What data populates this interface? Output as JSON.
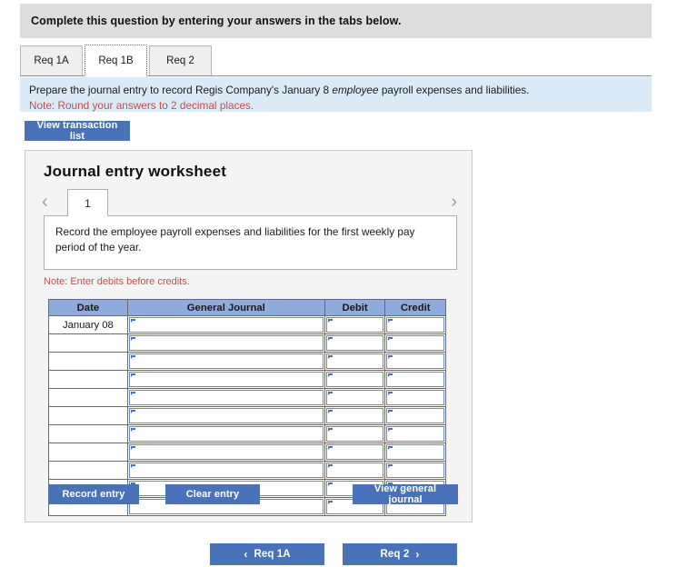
{
  "header": {
    "instruction": "Complete this question by entering your answers in the tabs below."
  },
  "tabs": {
    "items": [
      {
        "label": "Req 1A",
        "active": false
      },
      {
        "label": "Req 1B",
        "active": true
      },
      {
        "label": "Req 2",
        "active": false
      }
    ]
  },
  "prompt": {
    "line_prefix": "Prepare the journal entry to record Regis Company's January 8 ",
    "line_emphasis": "employee",
    "line_suffix": " payroll expenses and liabilities.",
    "note": "Note: Round your answers to 2 decimal places."
  },
  "toolbar": {
    "view_transaction_list": "View transaction list"
  },
  "worksheet": {
    "title": "Journal entry worksheet",
    "pager": {
      "prev_icon": "‹",
      "next_icon": "›",
      "current_page": "1"
    },
    "description": "Record the employee payroll expenses and liabilities for the first weekly pay period of the year.",
    "debit_note": "Note: Enter debits before credits.",
    "table": {
      "columns": [
        "Date",
        "General Journal",
        "Debit",
        "Credit"
      ],
      "rows": [
        {
          "date": "January 08",
          "general_journal": "",
          "debit": "",
          "credit": ""
        },
        {
          "date": "",
          "general_journal": "",
          "debit": "",
          "credit": ""
        },
        {
          "date": "",
          "general_journal": "",
          "debit": "",
          "credit": ""
        },
        {
          "date": "",
          "general_journal": "",
          "debit": "",
          "credit": ""
        },
        {
          "date": "",
          "general_journal": "",
          "debit": "",
          "credit": ""
        },
        {
          "date": "",
          "general_journal": "",
          "debit": "",
          "credit": ""
        },
        {
          "date": "",
          "general_journal": "",
          "debit": "",
          "credit": ""
        },
        {
          "date": "",
          "general_journal": "",
          "debit": "",
          "credit": ""
        },
        {
          "date": "",
          "general_journal": "",
          "debit": "",
          "credit": ""
        },
        {
          "date": "",
          "general_journal": "",
          "debit": "",
          "credit": ""
        },
        {
          "date": "",
          "general_journal": "",
          "debit": "",
          "credit": ""
        }
      ]
    },
    "actions": {
      "record_entry": "Record entry",
      "clear_entry": "Clear entry",
      "view_general_journal": "View general journal"
    }
  },
  "bottom_nav": {
    "prev_icon": "‹",
    "prev_label": "Req 1A",
    "next_label": "Req 2",
    "next_icon": "›"
  },
  "colors": {
    "accent_blue": "#4a72b8",
    "table_header_blue": "#8faadc",
    "prompt_band_blue": "#daeaf7",
    "top_bar_gray": "#dddddd",
    "panel_gray": "#f4f4f4",
    "note_red": "#c0504d"
  }
}
